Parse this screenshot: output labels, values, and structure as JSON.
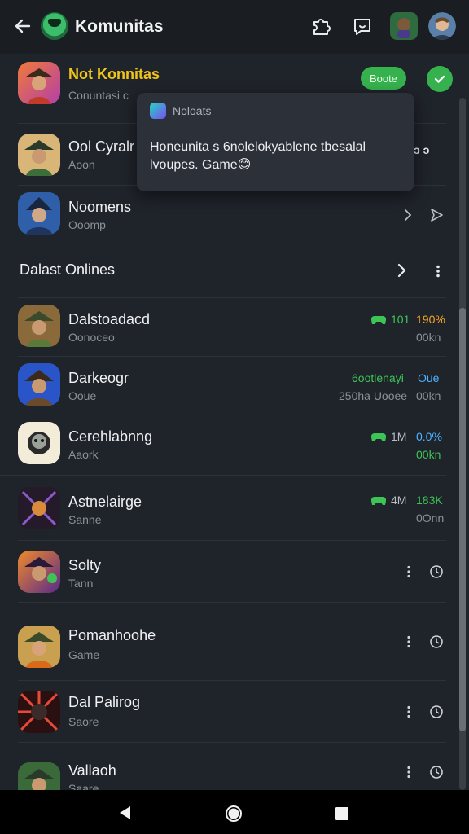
{
  "header": {
    "title": "Komunitas",
    "back_icon": "arrow-left-icon",
    "icons": [
      "puzzle-icon",
      "chat-bubble-icon"
    ]
  },
  "featured": {
    "name": "Not Konnitas",
    "sub": "Conuntasi c",
    "join_label": "Boote",
    "check_icon": "check-icon"
  },
  "tooltip": {
    "title": "Noloats",
    "body": "Honeunita s 6nolelokyablene tbesalal lvoupes. Game😊"
  },
  "rows_top": [
    {
      "name": "Ool Cyralr",
      "sub": "Aoon",
      "trailing": "ↄ ↄ"
    },
    {
      "name": "Noomens",
      "sub": "Ooomp"
    }
  ],
  "section": {
    "label": "Dalast Onlines"
  },
  "games": [
    {
      "name": "Dalstoadacd",
      "sub": "Oonoceo",
      "stat1": "101",
      "stat2": "190%",
      "stat3": "00kn",
      "stat1_color": "#3ec456",
      "stat2_color": "#f5a623"
    },
    {
      "name": "Darkeogr",
      "sub": "Ooue",
      "stat1": "6ootlenayi",
      "stat2": "Oue",
      "stat3": "00kn",
      "stat4": "250ha Uooee",
      "stat1_color": "#3ec456",
      "stat2_color": "#4fb3ff"
    },
    {
      "name": "Cerehlabnng",
      "sub": "Aaork",
      "stat1": "1M",
      "stat2": "0.0%",
      "stat3": "00kn",
      "stat1_color": "#b8bcc3",
      "stat2_color": "#4fb3ff",
      "stat3_color": "#3ec456"
    },
    {
      "name": "Astnelairge",
      "sub": "Sanne",
      "stat1": "4M",
      "stat2": "183K",
      "stat3": "0Onn",
      "stat1_color": "#b8bcc3",
      "stat2_color": "#3ec456"
    },
    {
      "name": "Solty",
      "sub": "Tann"
    },
    {
      "name": "Pomanhoohe",
      "sub": "Game"
    },
    {
      "name": "Dal Palirog",
      "sub": "Saore"
    },
    {
      "name": "Vallaoh",
      "sub": "Saare"
    }
  ],
  "colors": {
    "accent": "#35b24e",
    "featured_title": "#f0c419",
    "background": "#1f232a"
  }
}
